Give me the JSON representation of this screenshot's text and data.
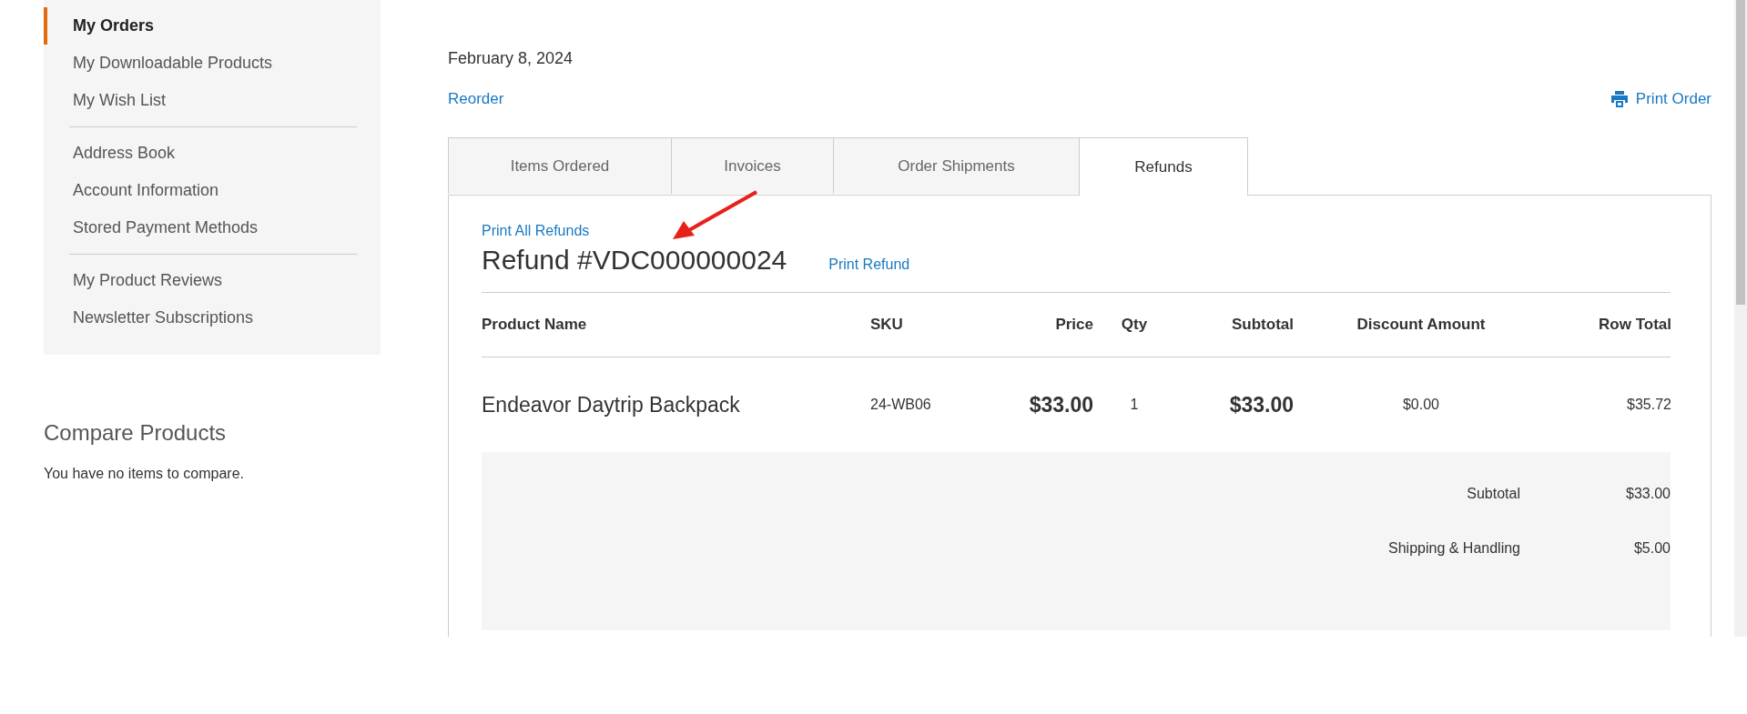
{
  "sidebar": {
    "groups": [
      {
        "items": [
          {
            "label": "My Orders",
            "selected": true
          },
          {
            "label": "My Downloadable Products",
            "selected": false
          },
          {
            "label": "My Wish List",
            "selected": false
          }
        ]
      },
      {
        "items": [
          {
            "label": "Address Book",
            "selected": false
          },
          {
            "label": "Account Information",
            "selected": false
          },
          {
            "label": "Stored Payment Methods",
            "selected": false
          }
        ]
      },
      {
        "items": [
          {
            "label": "My Product Reviews",
            "selected": false
          },
          {
            "label": "Newsletter Subscriptions",
            "selected": false
          }
        ]
      }
    ]
  },
  "compare": {
    "title": "Compare Products",
    "message": "You have no items to compare."
  },
  "order": {
    "date": "February 8, 2024",
    "reorder_link": "Reorder",
    "print_order_link": "Print Order"
  },
  "tabs": [
    {
      "label": "Items Ordered",
      "selected": false
    },
    {
      "label": "Invoices",
      "selected": false
    },
    {
      "label": "Order Shipments",
      "selected": false
    },
    {
      "label": "Refunds",
      "selected": true
    }
  ],
  "refund": {
    "print_all_link": "Print All Refunds",
    "title": "Refund #VDC000000024",
    "print_refund_link": "Print Refund",
    "columns": [
      "Product Name",
      "SKU",
      "Price",
      "Qty",
      "Subtotal",
      "Discount Amount",
      "Row Total"
    ],
    "rows": [
      {
        "cells": [
          "Endeavor Daytrip Backpack",
          "24-WB06",
          "$33.00",
          "1",
          "$33.00",
          "$0.00",
          "$35.72"
        ]
      }
    ],
    "totals": [
      {
        "label": "Subtotal",
        "value": "$33.00"
      },
      {
        "label": "Shipping & Handling",
        "value": "$5.00"
      }
    ]
  }
}
